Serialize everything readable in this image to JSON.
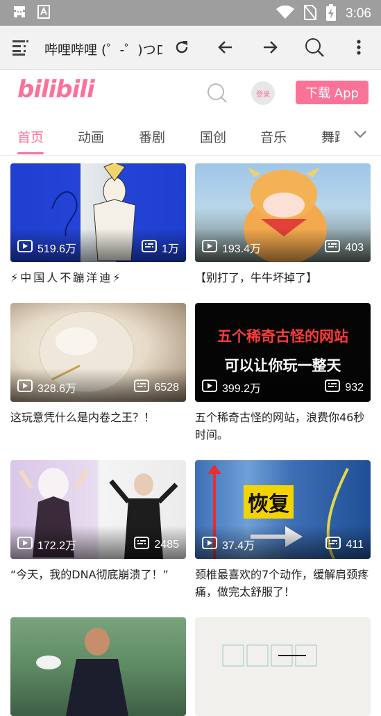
{
  "status_bar": {
    "time": "3:06",
    "icons": [
      "ghost-icon",
      "text-app-icon",
      "wifi-icon",
      "no-sim-icon",
      "battery-charging-icon"
    ]
  },
  "browser": {
    "page_title": "哔哩哔哩 (゜-゜)つロ 干杯~-bilibili",
    "icons": [
      "tabs-menu-icon",
      "reload-icon",
      "back-icon",
      "forward-icon",
      "search-icon",
      "more-icon"
    ]
  },
  "header": {
    "logo": "bilibili",
    "login_label": "登录",
    "download_label": "下载 App"
  },
  "tabs": {
    "items": [
      "首页",
      "动画",
      "番剧",
      "国创",
      "音乐",
      "舞蹈"
    ],
    "active_index": 0
  },
  "videos": [
    {
      "title": "⚡中国人不蹦洋迪⚡",
      "plays": "519.6万",
      "danmaku": "1万"
    },
    {
      "title": "【别打了，牛牛坏掉了】",
      "plays": "193.4万",
      "danmaku": "403"
    },
    {
      "title": "这玩意凭什么是内卷之王？！",
      "plays": "328.6万",
      "danmaku": "6528"
    },
    {
      "title": "五个稀奇古怪的网站，浪费你46秒时间。",
      "plays": "399.2万",
      "danmaku": "932",
      "thumb_text_1": "五个稀奇古怪的网站",
      "thumb_text_2": "可以让你玩一整天"
    },
    {
      "title": "“今天，我的DNA彻底崩溃了！”",
      "plays": "172.2万",
      "danmaku": "2485"
    },
    {
      "title": "颈椎最喜欢的7个动作，缓解肩颈疼痛，做完太舒服了！",
      "plays": "37.4万",
      "danmaku": "411",
      "thumb_text_1": "恢复"
    },
    {
      "title": "",
      "plays": "",
      "danmaku": ""
    },
    {
      "title": "",
      "plays": "",
      "danmaku": ""
    }
  ],
  "colors": {
    "accent": "#fb7299",
    "status_bar": "#9e9e9e",
    "browser_bar": "#f2f2f2"
  }
}
